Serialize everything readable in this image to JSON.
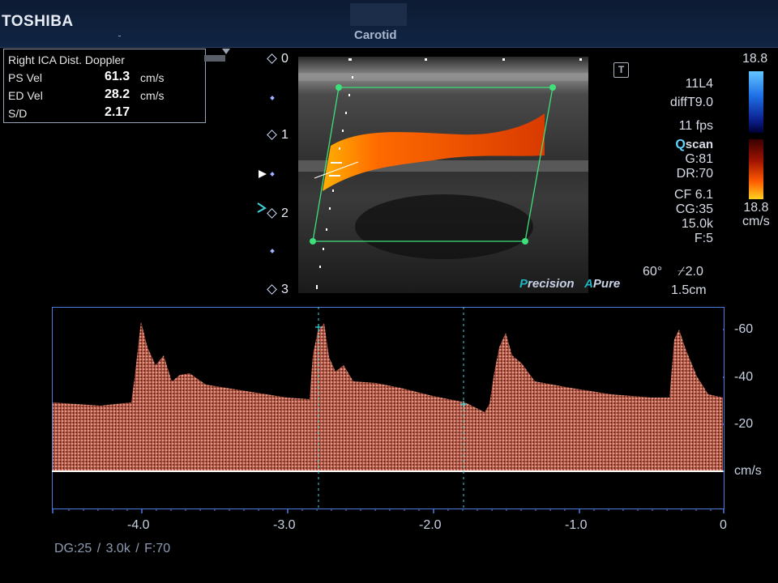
{
  "header": {
    "brand": "TOSHIBA",
    "preset": "Carotid"
  },
  "measurement": {
    "title": "Right ICA Dist. Doppler",
    "rows": [
      {
        "label": "PS Vel",
        "value": "61.3",
        "unit": "cm/s"
      },
      {
        "label": "ED Vel",
        "value": "28.2",
        "unit": "cm/s"
      },
      {
        "label": "S/D",
        "value": "2.17",
        "unit": ""
      }
    ]
  },
  "depth_scale": [
    "0",
    "1",
    "2",
    "3"
  ],
  "params": {
    "probe": "11L4",
    "mode": "diffT9.0",
    "fps": "11 fps",
    "qscan_q": "Q",
    "qscan_rest": "scan",
    "gain": "G:81",
    "dr": "DR:70",
    "cf": "CF 6.1",
    "cg": "CG:35",
    "prf": "15.0k",
    "filter": "F:5",
    "angle": "60°",
    "steer": "2.0",
    "focus": "1.5cm",
    "tbox": "T"
  },
  "color_scale": {
    "top": "18.8",
    "bottom": "18.8",
    "unit": "cm/s",
    "colors": {
      "pos_max": "#ffd21f",
      "neg_max": "#63c6ff"
    }
  },
  "brandbar": {
    "p": "P",
    "precision": "recision",
    "a": "A",
    "pure": "Pure"
  },
  "spectrum": {
    "y_ticks": [
      "-60",
      "-40",
      "-20",
      "cm/s"
    ],
    "x_ticks": [
      "-4.0",
      "-3.0",
      "-2.0",
      "-1.0",
      "0"
    ],
    "colors": {
      "spectrum": "#e0806a",
      "baseline": "#ffffff",
      "cursor": "#3fd4e0",
      "frame": "#4f7be0"
    }
  },
  "footer": "DG:25 / 3.0k / F:70"
}
